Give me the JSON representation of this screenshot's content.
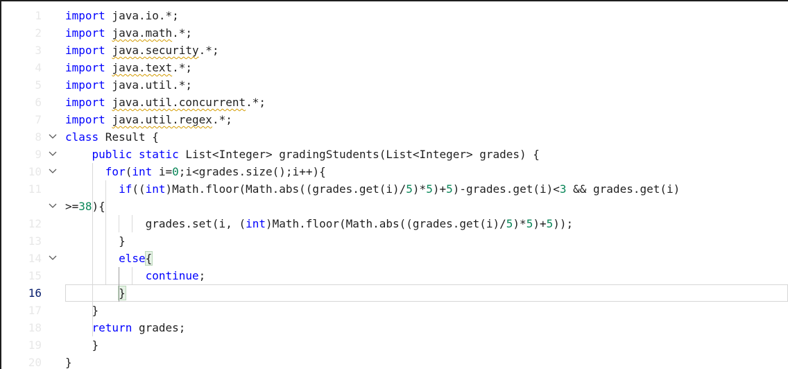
{
  "editor": {
    "active_line_index": 17,
    "lines": [
      {
        "num": "1",
        "fold": false,
        "tokens": [
          [
            "kw",
            "import"
          ],
          [
            "t",
            " java.io.*;"
          ]
        ]
      },
      {
        "num": "2",
        "fold": false,
        "tokens": [
          [
            "kw",
            "import"
          ],
          [
            "t",
            " "
          ],
          [
            "sq",
            "java.math"
          ],
          [
            "t",
            ".*;"
          ]
        ]
      },
      {
        "num": "3",
        "fold": false,
        "tokens": [
          [
            "kw",
            "import"
          ],
          [
            "t",
            " "
          ],
          [
            "sq",
            "java.security"
          ],
          [
            "t",
            ".*;"
          ]
        ]
      },
      {
        "num": "4",
        "fold": false,
        "tokens": [
          [
            "kw",
            "import"
          ],
          [
            "t",
            " "
          ],
          [
            "sq",
            "java.text"
          ],
          [
            "t",
            ".*;"
          ]
        ]
      },
      {
        "num": "5",
        "fold": false,
        "tokens": [
          [
            "kw",
            "import"
          ],
          [
            "t",
            " java.util.*;"
          ]
        ]
      },
      {
        "num": "6",
        "fold": false,
        "tokens": [
          [
            "kw",
            "import"
          ],
          [
            "t",
            " "
          ],
          [
            "sq",
            "java.util.concurrent"
          ],
          [
            "t",
            ".*;"
          ]
        ]
      },
      {
        "num": "7",
        "fold": false,
        "tokens": [
          [
            "kw",
            "import"
          ],
          [
            "t",
            " "
          ],
          [
            "sq",
            "java.util.regex"
          ],
          [
            "t",
            ".*;"
          ]
        ]
      },
      {
        "num": "8",
        "fold": true,
        "tokens": [
          [
            "kw",
            "class"
          ],
          [
            "t",
            " Result {"
          ]
        ]
      },
      {
        "num": "9",
        "fold": true,
        "tokens": [
          [
            "t",
            "    "
          ],
          [
            "kw",
            "public"
          ],
          [
            "t",
            " "
          ],
          [
            "kw",
            "static"
          ],
          [
            "t",
            " List<Integer> gradingStudents(List<Integer> grades) {"
          ]
        ]
      },
      {
        "num": "10",
        "fold": true,
        "tokens": [
          [
            "t",
            "      "
          ],
          [
            "kw",
            "for"
          ],
          [
            "t",
            "("
          ],
          [
            "kw",
            "int"
          ],
          [
            "t",
            " i="
          ],
          [
            "num",
            "0"
          ],
          [
            "t",
            ";i<grades.size();i++){"
          ]
        ]
      },
      {
        "num": "11",
        "fold": false,
        "tokens": [
          [
            "t",
            "        "
          ],
          [
            "kw",
            "if"
          ],
          [
            "t",
            "(("
          ],
          [
            "kw",
            "int"
          ],
          [
            "t",
            ")Math.floor(Math.abs((grades.get(i)/"
          ],
          [
            "num",
            "5"
          ],
          [
            "t",
            ")*"
          ],
          [
            "num",
            "5"
          ],
          [
            "t",
            ")+"
          ],
          [
            "num",
            "5"
          ],
          [
            "t",
            ")-grades.get(i)<"
          ],
          [
            "num",
            "3"
          ],
          [
            "t",
            " && grades.get(i)"
          ]
        ]
      },
      {
        "num": "",
        "fold": true,
        "wrap": true,
        "tokens": [
          [
            "t",
            ">="
          ],
          [
            "num",
            "38"
          ],
          [
            "t",
            "){"
          ]
        ]
      },
      {
        "num": "12",
        "fold": false,
        "tokens": [
          [
            "t",
            "            grades.set(i, ("
          ],
          [
            "kw",
            "int"
          ],
          [
            "t",
            ")Math.floor(Math.abs((grades.get(i)/"
          ],
          [
            "num",
            "5"
          ],
          [
            "t",
            ")*"
          ],
          [
            "num",
            "5"
          ],
          [
            "t",
            ")+"
          ],
          [
            "num",
            "5"
          ],
          [
            "t",
            "));"
          ]
        ]
      },
      {
        "num": "13",
        "fold": false,
        "tokens": [
          [
            "t",
            "        }"
          ]
        ]
      },
      {
        "num": "14",
        "fold": true,
        "tokens": [
          [
            "t",
            "        "
          ],
          [
            "kw",
            "else"
          ],
          [
            "bb",
            "{"
          ]
        ]
      },
      {
        "num": "15",
        "fold": false,
        "tokens": [
          [
            "t",
            "            "
          ],
          [
            "kw",
            "continue"
          ],
          [
            "t",
            ";"
          ]
        ]
      },
      {
        "num": "16",
        "fold": false,
        "active": true,
        "tokens": [
          [
            "t",
            "        "
          ],
          [
            "bb",
            "}"
          ]
        ]
      },
      {
        "num": "17",
        "fold": false,
        "tokens": [
          [
            "t",
            "    }"
          ]
        ]
      },
      {
        "num": "18",
        "fold": false,
        "tokens": [
          [
            "t",
            "    "
          ],
          [
            "kw",
            "return"
          ],
          [
            "t",
            " grades;"
          ]
        ]
      },
      {
        "num": "19",
        "fold": false,
        "tokens": [
          [
            "t",
            "    }"
          ]
        ]
      },
      {
        "num": "20",
        "fold": false,
        "tokens": [
          [
            "t",
            "}"
          ]
        ]
      }
    ],
    "colors": {
      "keyword": "#0000ff",
      "number": "#098658",
      "text": "#1f1f1f",
      "active_line_number": "#0b216f",
      "squiggle": "#d49b00"
    },
    "icons": {
      "fold": "chevron-down-icon"
    }
  }
}
